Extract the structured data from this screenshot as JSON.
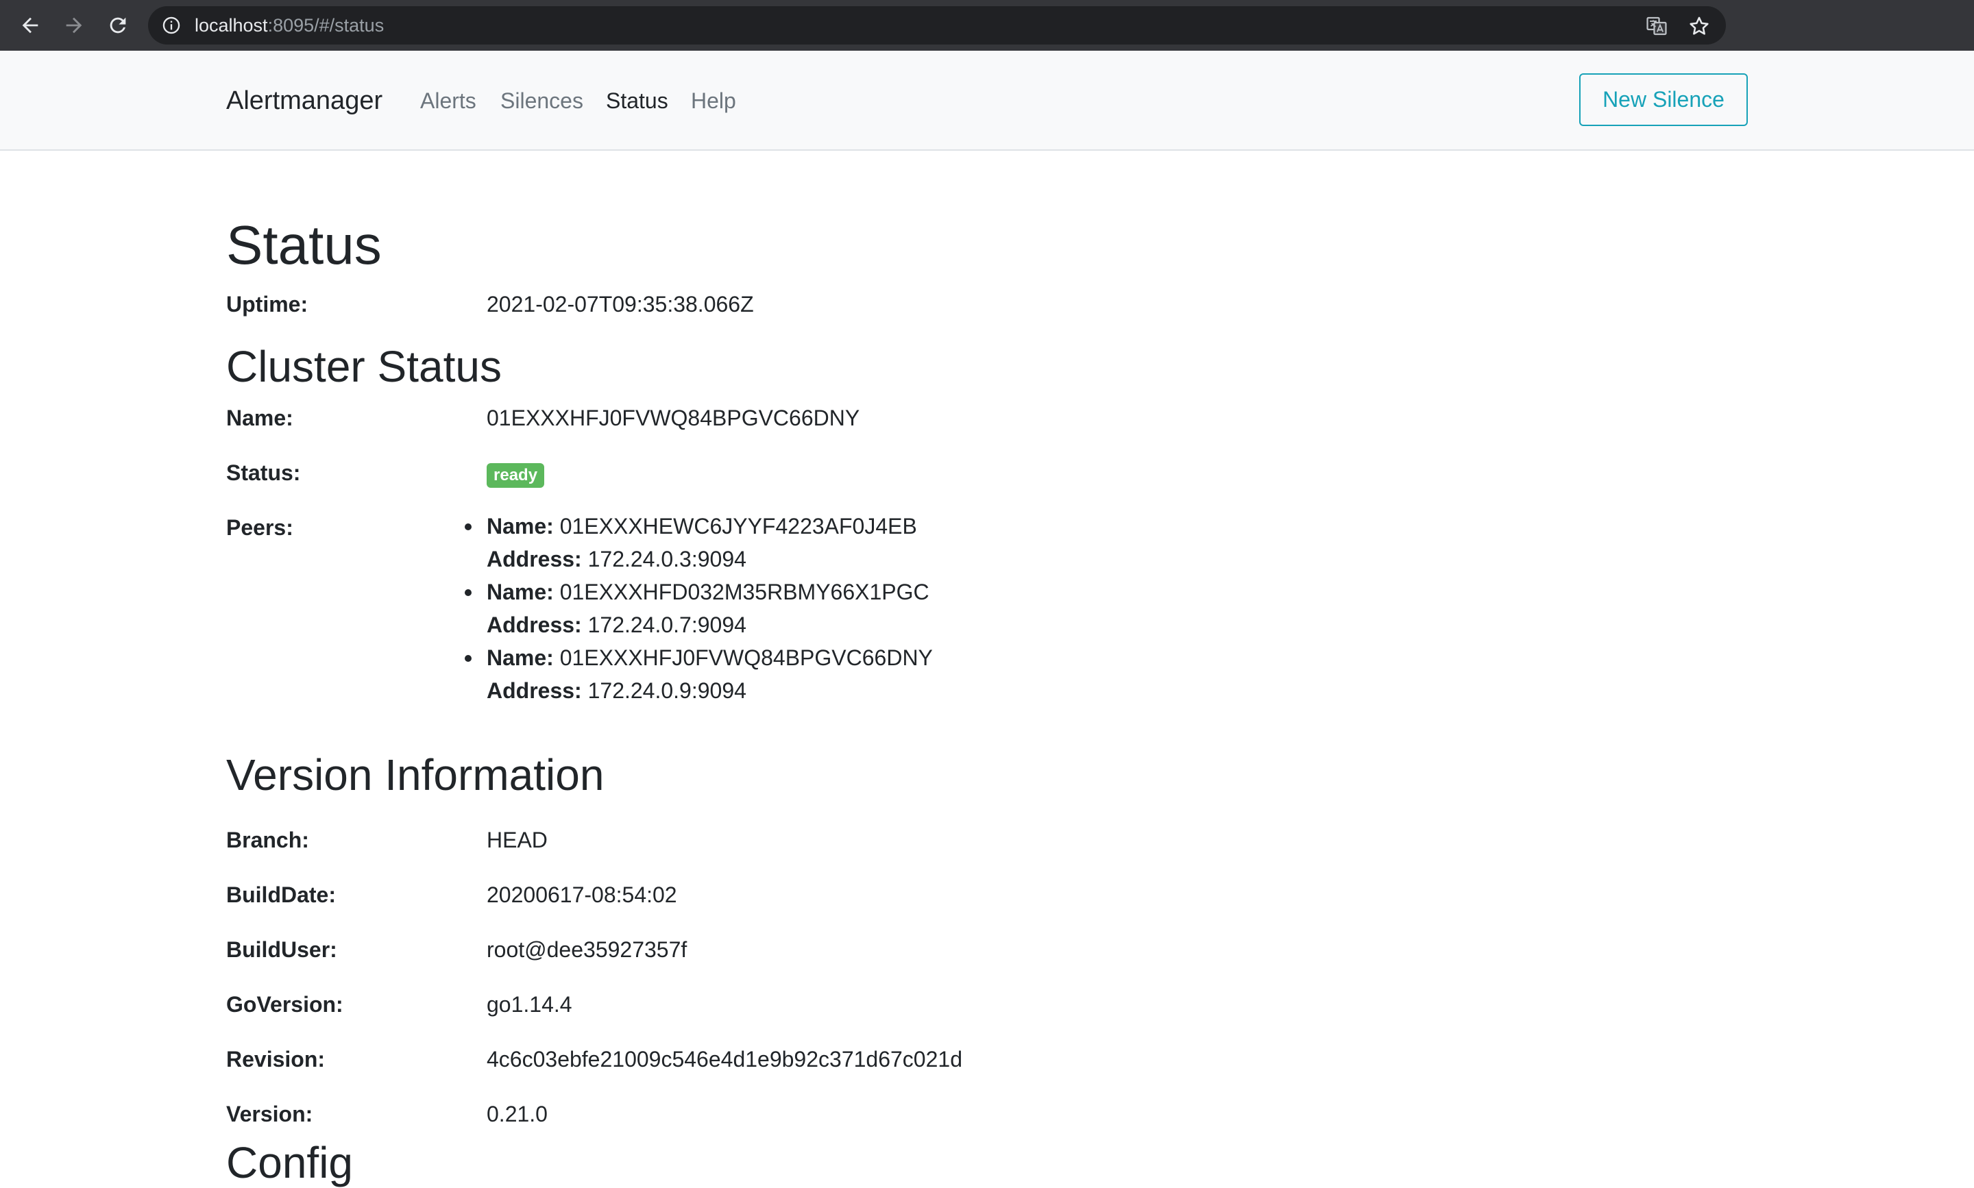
{
  "browser": {
    "url_host": "localhost",
    "url_rest": ":8095/#/status"
  },
  "navbar": {
    "brand": "Alertmanager",
    "links": [
      "Alerts",
      "Silences",
      "Status",
      "Help"
    ],
    "active_link": "Status",
    "new_silence_label": "New Silence"
  },
  "status": {
    "title": "Status",
    "uptime_label": "Uptime:",
    "uptime_value": "2021-02-07T09:35:38.066Z"
  },
  "cluster": {
    "title": "Cluster Status",
    "name_label": "Name:",
    "name_value": "01EXXXHFJ0FVWQ84BPGVC66DNY",
    "status_label": "Status:",
    "status_value": "ready",
    "peers_label": "Peers:",
    "peer_name_label": "Name:",
    "peer_address_label": "Address:",
    "peers": [
      {
        "name": "01EXXXHEWC6JYYF4223AF0J4EB",
        "address": "172.24.0.3:9094"
      },
      {
        "name": "01EXXXHFD032M35RBMY66X1PGC",
        "address": "172.24.0.7:9094"
      },
      {
        "name": "01EXXXHFJ0FVWQ84BPGVC66DNY",
        "address": "172.24.0.9:9094"
      }
    ]
  },
  "version": {
    "title": "Version Information",
    "rows": [
      {
        "label": "Branch:",
        "value": "HEAD"
      },
      {
        "label": "BuildDate:",
        "value": "20200617-08:54:02"
      },
      {
        "label": "BuildUser:",
        "value": "root@dee35927357f"
      },
      {
        "label": "GoVersion:",
        "value": "go1.14.4"
      },
      {
        "label": "Revision:",
        "value": "4c6c03ebfe21009c546e4d1e9b92c371d67c021d"
      },
      {
        "label": "Version:",
        "value": "0.21.0"
      }
    ]
  },
  "config": {
    "title": "Config"
  },
  "colors": {
    "badge_ready": "#5cb85c",
    "button_outline": "#17a2b8",
    "chrome_bg": "#35363a"
  }
}
